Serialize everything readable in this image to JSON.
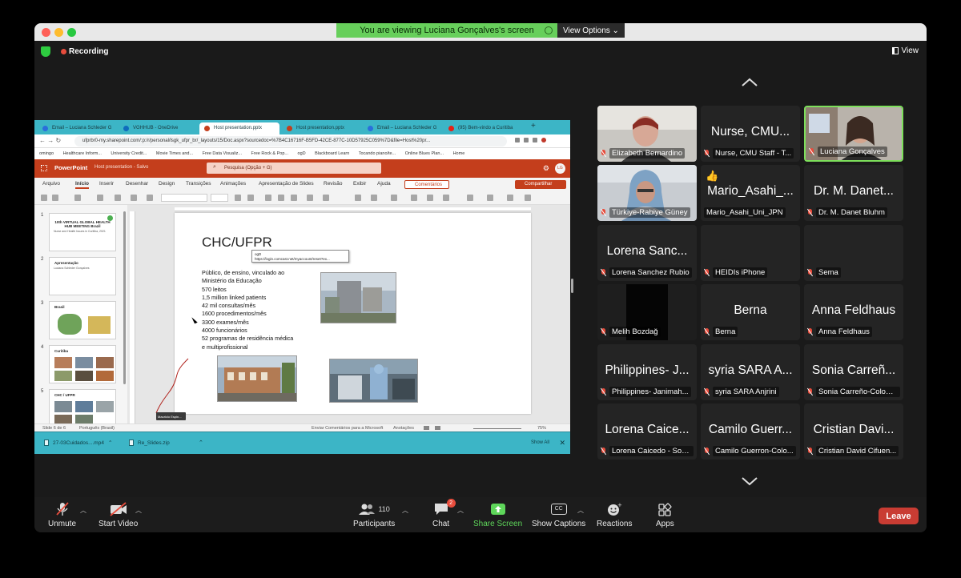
{
  "banner": {
    "text": "You are viewing Luciana Gonçalves's screen",
    "view_options": "View Options"
  },
  "topbar": {
    "recording": "Recording",
    "view": "View"
  },
  "browser": {
    "tabs": [
      "Email – Luciana Schleder G",
      "VGHHUB - OneDrive",
      "Host presentation.pptx",
      "Host presentation.pptx",
      "Email – Luciana Schleder G",
      "(95) Bem-vindo a Curitiba"
    ],
    "url": "ufprbr0-my.sharepoint.com/:p:/r/personal/lsgk_ufpr_br/_layouts/15/Doc.aspx?sourcedoc=%7B4C16716F-B5FD-42CE-877C-10D57925C059%7D&file=Host%20pr...",
    "bookmarks": [
      "omingo",
      "Healthcare Inform...",
      "University Credit...",
      "Movie Times and...",
      "Free Data Visualiz...",
      "Free Rock & Pop...",
      "ogD",
      "Blackboard Learn",
      "Tocando piano/te...",
      "Online Blues Plan...",
      "Home"
    ]
  },
  "powerpoint": {
    "app": "PowerPoint",
    "doc": "Host presentation - Salvo",
    "search": "Pesquisa (Opção + G)",
    "avatar": "LG",
    "menu": [
      "Arquivo",
      "Início",
      "Inserir",
      "Desenhar",
      "Design",
      "Transições",
      "Animações",
      "Apresentação de Slides",
      "Revisão",
      "Exibir",
      "Ajuda"
    ],
    "comments": "Comentários",
    "share": "Compartilhar",
    "thumbnails": [
      {
        "num": "1",
        "title": "10th VIRTUAL GLOBAL HEALTH HUB MEETING Brazil",
        "sub": "Nurse and Health Issues in Curitiba, 2021"
      },
      {
        "num": "2",
        "title": "Apresentação",
        "sub": "Luciana Schleder Gonçalves"
      },
      {
        "num": "3",
        "title": "Brasil",
        "sub": ""
      },
      {
        "num": "4",
        "title": "Curitiba",
        "sub": ""
      },
      {
        "num": "5",
        "title": "CHC / UFPR",
        "sub": ""
      }
    ],
    "slide": {
      "title": "CHC/UFPR",
      "lines": [
        "Público, de ensino, vinculado ao",
        "Ministério da Educação",
        "570 leitos",
        "1,5 million linked patients",
        "42 mil consultas/mês",
        "1600 procedimentos/mês",
        "3300 exames/mês",
        "4000 funcionários",
        "52 programas de residência médica",
        "e multiprofissional"
      ],
      "tooltip_title": "ogD",
      "tooltip_url": "https://login.comcast.net/myaccount/reset?ex..."
    },
    "presenter_tag": "Mauricio Espin...",
    "status": {
      "slide": "Slide 6 de 6",
      "lang": "Português (Brasil)",
      "feedback": "Enviar Comentários para a Microsoft",
      "notes": "Anotações",
      "zoom": "75%"
    }
  },
  "downloads": {
    "items": [
      "27-03Cuidados....mp4",
      "Re_Slides.zip"
    ],
    "show_all": "Show All"
  },
  "gallery": [
    {
      "label": "Elizabeth Bernardino",
      "big": "",
      "video": true
    },
    {
      "label": "Nurse, CMU Staff - T...",
      "big": "Nurse, CMU...",
      "video": false
    },
    {
      "label": "Luciana Gonçalves",
      "big": "",
      "video": true,
      "active": true
    },
    {
      "label": "Türkiye-Rabiye Güney",
      "big": "",
      "video": true
    },
    {
      "label": "Mario_Asahi_Uni_JPN",
      "big": "Mario_Asahi_...",
      "video": false
    },
    {
      "label": "Dr. M. Danet Bluhm",
      "big": "Dr. M. Danet...",
      "video": false
    },
    {
      "label": "Lorena Sanchez Rubio",
      "big": "Lorena Sanc...",
      "video": false
    },
    {
      "label": "HEIDIs iPhone",
      "big": "",
      "video": false
    },
    {
      "label": "Sema",
      "big": "",
      "video": false
    },
    {
      "label": "Melih Bozdağ",
      "big": "",
      "video": true
    },
    {
      "label": "Berna",
      "big": "Berna",
      "video": false
    },
    {
      "label": "Anna Feldhaus",
      "big": "Anna Feldhaus",
      "video": false
    },
    {
      "label": "Philippines- Janimah...",
      "big": "Philippines- J...",
      "video": false
    },
    {
      "label": "syria SARA Anjrini",
      "big": "syria SARA A...",
      "video": false
    },
    {
      "label": "Sonia Carreño-Colom...",
      "big": "Sonia Carreñ...",
      "video": false
    },
    {
      "label": "Lorena Caicedo - Son...",
      "big": "Lorena Caice...",
      "video": false
    },
    {
      "label": "Camilo Guerron-Colo...",
      "big": "Camilo Guerr...",
      "video": false
    },
    {
      "label": "Cristian David Cifuen...",
      "big": "Cristian Davi...",
      "video": false
    }
  ],
  "controls": {
    "unmute": "Unmute",
    "start_video": "Start Video",
    "participants": "Participants",
    "participants_count": "110",
    "chat": "Chat",
    "chat_badge": "2",
    "share_screen": "Share Screen",
    "captions": "Show Captions",
    "captions_icon": "CC",
    "reactions": "Reactions",
    "apps": "Apps",
    "leave": "Leave"
  }
}
